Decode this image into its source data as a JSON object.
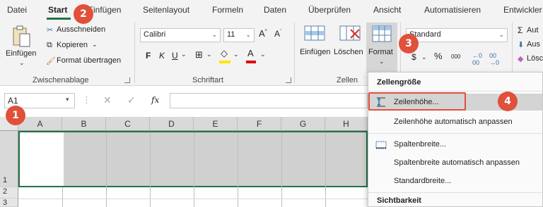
{
  "tabs": [
    "Datei",
    "Start",
    "Einfügen",
    "Seitenlayout",
    "Formeln",
    "Daten",
    "Überprüfen",
    "Ansicht",
    "Automatisieren",
    "Entwickler"
  ],
  "clipboard": {
    "paste": "Einfügen",
    "cut": "Ausschneiden",
    "copy": "Kopieren",
    "format_painter": "Format übertragen",
    "group_label": "Zwischenablage"
  },
  "font": {
    "name": "Calibri",
    "size": "11",
    "bold": "F",
    "italic": "K",
    "underline": "U",
    "group_label": "Schriftart"
  },
  "cells": {
    "insert": "Einfügen",
    "delete": "Löschen",
    "format": "Format",
    "group_label": "Zellen"
  },
  "number": {
    "format_value": "Standard",
    "percent": "%",
    "thousands": "000"
  },
  "editing": {
    "autosum": "Aut",
    "fill": "Aus",
    "clear": "Lösc"
  },
  "formula_bar": {
    "name_box": "A1",
    "fx": "fx"
  },
  "grid": {
    "columns": [
      "A",
      "B",
      "C",
      "D",
      "E",
      "F",
      "G",
      "H"
    ],
    "rows": [
      "1",
      "2",
      "3"
    ]
  },
  "menu": {
    "section_cell_size": "Zellengröße",
    "row_height": "Zeilenhöhe...",
    "autofit_row": "Zeilenhöhe automatisch anpassen",
    "column_width": "Spaltenbreite...",
    "autofit_column": "Spaltenbreite automatisch anpassen",
    "default_width": "Standardbreite...",
    "section_visibility": "Sichtbarkeit"
  },
  "callouts": [
    "1",
    "2",
    "3",
    "4"
  ],
  "colors": {
    "accent": "#217346",
    "callout": "#e0503a",
    "selection": "#d0d0d0"
  }
}
